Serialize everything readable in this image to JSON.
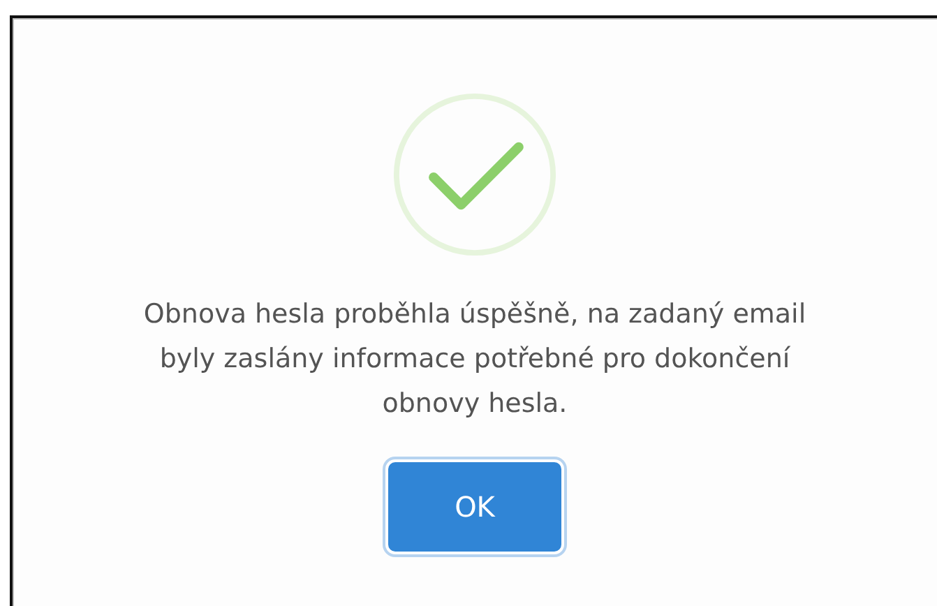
{
  "dialog": {
    "kind": "success",
    "message": "Obnova hesla proběhla úspěšně, na zadaný email byly zaslány informace potřebné pro dokončení obnovy hesla.",
    "buttons": [
      {
        "label": "OK",
        "focused": true
      }
    ]
  }
}
